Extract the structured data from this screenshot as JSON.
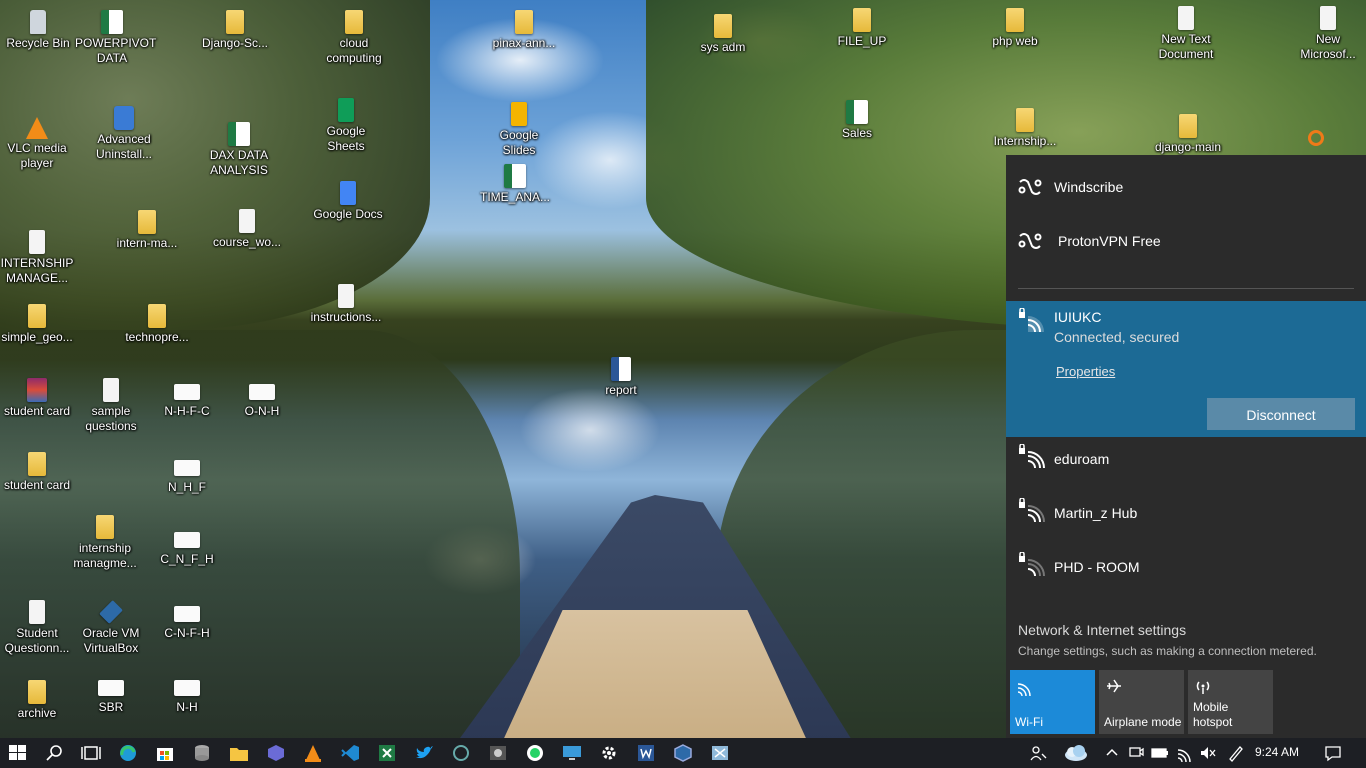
{
  "desktop_icons": [
    {
      "label": "Recycle Bin",
      "type": "recycle"
    },
    {
      "label": "POWERPIVOT DATA",
      "type": "excel"
    },
    {
      "label": "Django-Sc...",
      "type": "folder"
    },
    {
      "label": "cloud computing",
      "type": "folder"
    },
    {
      "label": "pinax-ann...",
      "type": "folder"
    },
    {
      "label": "sys adm",
      "type": "folder"
    },
    {
      "label": "FILE_UP",
      "type": "folder"
    },
    {
      "label": "php web",
      "type": "folder"
    },
    {
      "label": "New Text Document",
      "type": "doc"
    },
    {
      "label": "New Microsof...",
      "type": "doc"
    },
    {
      "label": "VLC media player",
      "type": "vlc"
    },
    {
      "label": "Advanced Uninstall...",
      "type": "app"
    },
    {
      "label": "DAX DATA ANALYSIS",
      "type": "excel"
    },
    {
      "label": "Google Sheets",
      "type": "gsheet"
    },
    {
      "label": "Google Slides",
      "type": "gslide"
    },
    {
      "label": "Sales",
      "type": "excel"
    },
    {
      "label": "Internship...",
      "type": "folder"
    },
    {
      "label": "django-main",
      "type": "folder"
    },
    {
      "label": "Google Docs",
      "type": "gdoc"
    },
    {
      "label": "TIME_ANA...",
      "type": "excel"
    },
    {
      "label": "intern-ma...",
      "type": "folder"
    },
    {
      "label": "course_wo...",
      "type": "doc"
    },
    {
      "label": "INTERNSHIP MANAGE...",
      "type": "doc"
    },
    {
      "label": "instructions...",
      "type": "doc"
    },
    {
      "label": "simple_geo...",
      "type": "folder"
    },
    {
      "label": "technopre...",
      "type": "folder"
    },
    {
      "label": "report",
      "type": "word"
    },
    {
      "label": "student card",
      "type": "rar"
    },
    {
      "label": "sample questions",
      "type": "doc"
    },
    {
      "label": "N-H-F-C",
      "type": "img"
    },
    {
      "label": "O-N-H",
      "type": "img"
    },
    {
      "label": "student card",
      "type": "folder"
    },
    {
      "label": "N_H_F",
      "type": "img"
    },
    {
      "label": "internship managme...",
      "type": "folder"
    },
    {
      "label": "C_N_F_H",
      "type": "img"
    },
    {
      "label": "Student Questionn...",
      "type": "doc"
    },
    {
      "label": "Oracle VM VirtualBox",
      "type": "vbox"
    },
    {
      "label": "C-N-F-H",
      "type": "img"
    },
    {
      "label": "archive",
      "type": "folder"
    },
    {
      "label": "SBR",
      "type": "img"
    },
    {
      "label": "N-H",
      "type": "img"
    }
  ],
  "network_flyout": {
    "vpns": [
      {
        "name": "Windscribe",
        "icon": "vpn-icon"
      },
      {
        "name": "ProtonVPN Free",
        "icon": "vpn-icon"
      }
    ],
    "connected": {
      "name": "IUIUKC",
      "status": "Connected, secured",
      "properties_label": "Properties",
      "disconnect_label": "Disconnect"
    },
    "networks": [
      {
        "name": "eduroam",
        "icon": "wifi-secured-icon"
      },
      {
        "name": "Martin_z Hub",
        "icon": "wifi-secured-icon"
      },
      {
        "name": "PHD - ROOM",
        "icon": "wifi-secured-icon"
      }
    ],
    "settings_title": "Network & Internet settings",
    "settings_subtitle": "Change settings, such as making a connection metered.",
    "quick_actions": [
      {
        "label": "Wi-Fi",
        "icon": "wifi-icon",
        "on": true
      },
      {
        "label": "Airplane mode",
        "icon": "airplane-icon",
        "on": false
      },
      {
        "label": "Mobile hotspot",
        "icon": "hotspot-icon",
        "on": false
      }
    ]
  },
  "taskbar": {
    "time": "9:24 AM",
    "pinned": [
      "windows-start-icon",
      "search-icon",
      "task-view-icon",
      "edge-icon",
      "store-icon",
      "database-icon",
      "file-explorer-icon",
      "app-icon",
      "vlc-icon",
      "vscode-icon",
      "excel-icon",
      "twitter-icon",
      "chatgpt-icon",
      "media-icon",
      "whatsapp-icon",
      "remote-desktop-icon",
      "settings-icon",
      "word-icon",
      "virtualbox-icon",
      "snipping-tool-icon"
    ]
  },
  "colors": {
    "flyout_bg": "#2b2b2b",
    "connected_bg": "#1c6a95",
    "accent": "#1c8ad8",
    "taskbar_bg": "#1d1f24"
  }
}
